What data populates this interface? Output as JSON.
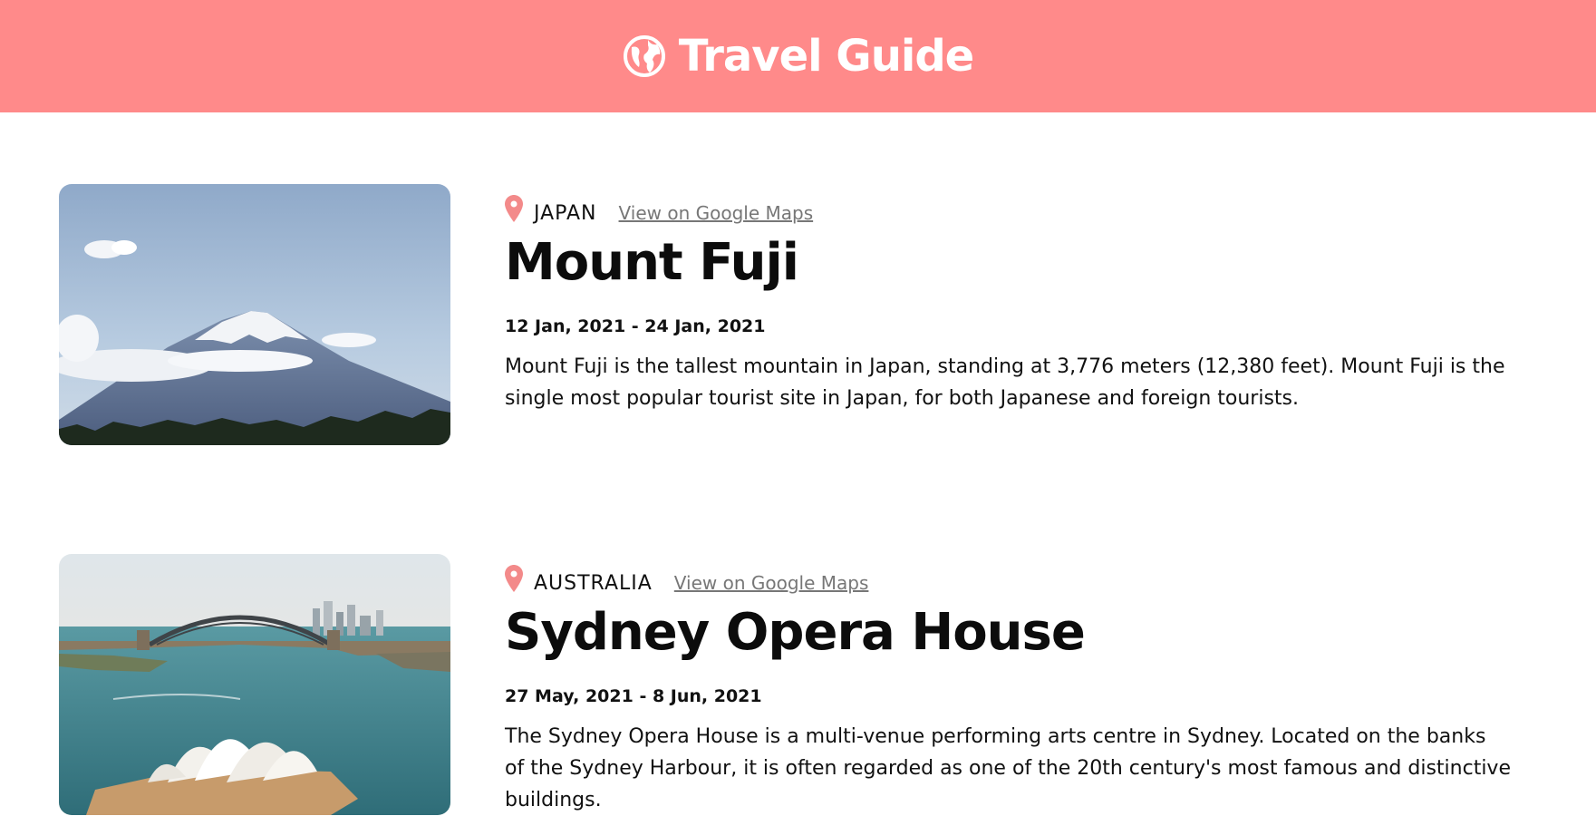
{
  "header": {
    "title": "Travel Guide",
    "icon": "globe-icon",
    "background_color": "#ff8a8a"
  },
  "entries": [
    {
      "country": "JAPAN",
      "maps_link": "View on Google Maps",
      "title": "Mount Fuji",
      "dates": "12 Jan, 2021 - 24 Jan, 2021",
      "description": "Mount Fuji is the tallest mountain in Japan, standing at 3,776 meters (12,380 feet). Mount Fuji is the single most popular tourist site in Japan, for both Japanese and foreign tourists."
    },
    {
      "country": "AUSTRALIA",
      "maps_link": "View on Google Maps",
      "title": "Sydney Opera House",
      "dates": "27 May, 2021 - 8 Jun, 2021",
      "description": "The Sydney Opera House is a multi-venue performing arts centre in Sydney. Located on the banks of the Sydney Harbour, it is often regarded as one of the 20th century's most famous and distinctive buildings."
    }
  ],
  "colors": {
    "accent": "#ff8a8a",
    "pin": "#f38a8a",
    "link": "#777777"
  }
}
